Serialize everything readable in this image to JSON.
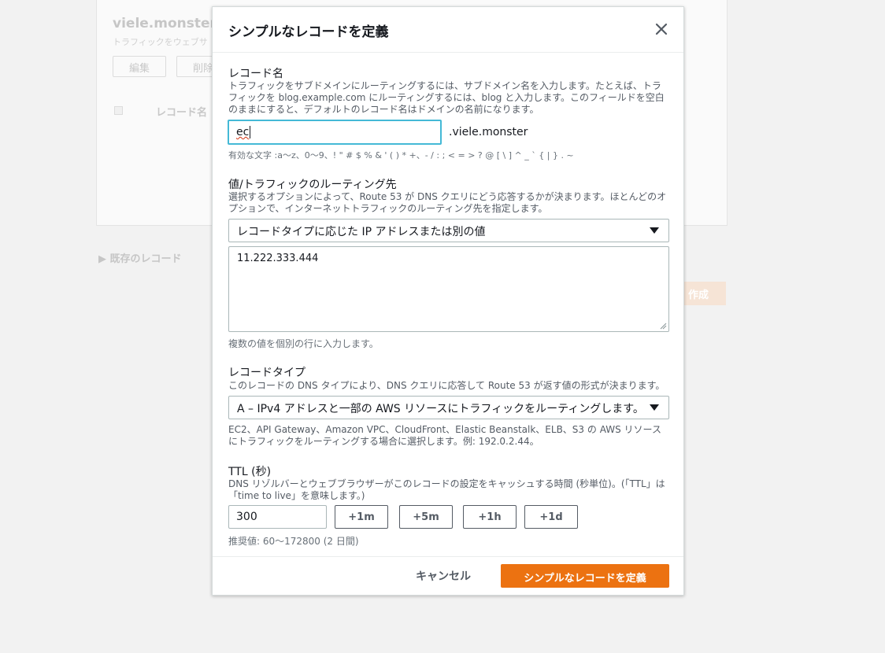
{
  "background": {
    "title": "viele.monster",
    "subtitle": "トラフィックをウェブサ",
    "buttons": [
      "編集",
      "削除"
    ],
    "column_header": "レコード名",
    "existing_records": "既存のレコード",
    "create_label": "作成"
  },
  "modal": {
    "title": "シンプルなレコードを定義",
    "close_icon": "close-icon"
  },
  "record_name": {
    "label": "レコード名",
    "description": "トラフィックをサブドメインにルーティングするには、サブドメイン名を入力します。たとえば、トラフィックを blog.example.com にルーティングするには、blog と入力します。このフィールドを空白のままにすると、デフォルトのレコード名はドメインの名前になります。",
    "value": "ec",
    "suffix": ".viele.monster",
    "valid_chars": "有効な文字 :a〜z、0〜9、! \" # $ % & ' ( ) * +、- / : ; < = > ? @ [ \\ ] ^ _ ` { | } . ~"
  },
  "routing": {
    "label": "値/トラフィックのルーティング先",
    "description": "選択するオプションによって、Route 53 が DNS クエリにどう応答するかが決まります。ほとんどのオプションで、インターネットトラフィックのルーティング先を指定します。",
    "selected": "レコードタイプに応じた IP アドレスまたは別の値",
    "value": "11.222.333.444",
    "hint": "複数の値を個別の行に入力します。"
  },
  "record_type": {
    "label": "レコードタイプ",
    "description": "このレコードの DNS タイプにより、DNS クエリに応答して Route 53 が返す値の形式が決まります。",
    "selected": "A – IPv4 アドレスと一部の AWS リソースにトラフィックをルーティングします。",
    "hint": "EC2、API Gateway、Amazon VPC、CloudFront、Elastic Beanstalk、ELB、S3 の AWS リソースにトラフィックをルーティングする場合に選択します。例: 192.0.2.44。"
  },
  "ttl": {
    "label": "TTL (秒)",
    "description": "DNS リゾルバーとウェブブラウザーがこのレコードの設定をキャッシュする時間 (秒単位)。(「TTL」は「time to live」を意味します。)",
    "value": "300",
    "buttons": [
      "+1m",
      "+5m",
      "+1h",
      "+1d"
    ],
    "hint": "推奨値: 60〜172800 (2 日間)"
  },
  "footer": {
    "cancel_label": "キャンセル",
    "submit_label": "シンプルなレコードを定義"
  },
  "colors": {
    "primary": "#ec7211",
    "focus": "#44b9d6"
  }
}
